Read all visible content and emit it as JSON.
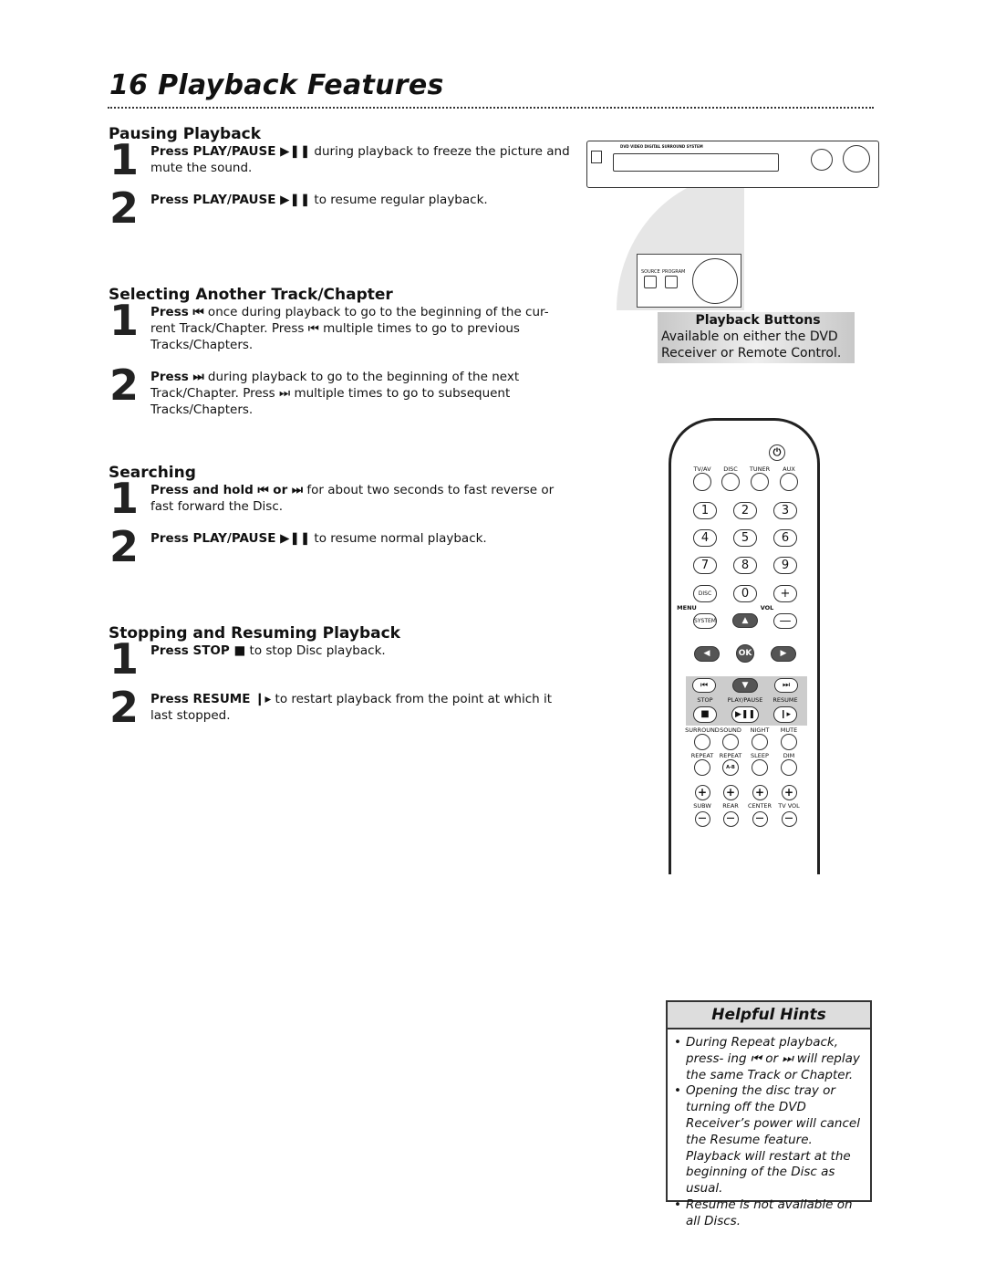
{
  "title": "16 Playback Features",
  "sections": [
    {
      "heading": "Pausing Playback",
      "steps": [
        {
          "n": "1",
          "bold": "Press PLAY/PAUSE ▶❚❚",
          "rest": " during playback to freeze the picture and mute the sound."
        },
        {
          "n": "2",
          "bold": "Press PLAY/PAUSE ▶❚❚",
          "rest": " to resume regular playback."
        }
      ]
    },
    {
      "heading": "Selecting Another Track/Chapter",
      "steps": [
        {
          "n": "1",
          "bold": "Press ⏮",
          "rest": " once during playback to go to the beginning of the cur- rent Track/Chapter. Press ⏮ multiple times to go to previous Tracks/Chapters."
        },
        {
          "n": "2",
          "bold": "Press ⏭",
          "rest": " during playback to go to the beginning of the next Track/Chapter. Press ⏭ multiple times to go to subsequent Tracks/Chapters."
        }
      ]
    },
    {
      "heading": "Searching",
      "steps": [
        {
          "n": "1",
          "bold": "Press and hold ⏮ or ⏭",
          "rest": " for about two seconds to fast reverse or fast forward the Disc."
        },
        {
          "n": "2",
          "bold": "Press PLAY/PAUSE ▶❚❚",
          "rest": " to resume normal playback."
        }
      ]
    },
    {
      "heading": "Stopping and Resuming Playback",
      "steps": [
        {
          "n": "1",
          "bold": "Press STOP ■",
          "rest": " to stop Disc playback."
        },
        {
          "n": "2",
          "bold": "Press RESUME ❙▸",
          "rest": " to restart playback from the point at which it last stopped."
        }
      ]
    }
  ],
  "caption": {
    "heading": "Playback Buttons",
    "text": "Available on either the DVD Receiver or Remote Control."
  },
  "player": {
    "label": "DVD VIDEO DIGITAL SURROUND SYSTEM",
    "zoom_labels": [
      "SOURCE",
      "PROGRAM"
    ]
  },
  "remote": {
    "source_labels": [
      "TV/AV",
      "DISC",
      "TUNER",
      "AUX"
    ],
    "numbers": [
      "1",
      "2",
      "3",
      "4",
      "5",
      "6",
      "7",
      "8",
      "9",
      "0"
    ],
    "disc": "DISC",
    "menu": "MENU",
    "system": "SYSTEM",
    "vol": "VOL",
    "plus": "+",
    "minus": "—",
    "ok": "OK",
    "transport_labels": [
      "STOP",
      "PLAY/PAUSE",
      "RESUME"
    ],
    "row1_labels": [
      "SURROUND",
      "SOUND",
      "NIGHT",
      "MUTE"
    ],
    "row2_labels": [
      "REPEAT",
      "REPEAT",
      "SLEEP",
      "DIM"
    ],
    "ab": "A-B",
    "vol_labels": [
      "SUBW",
      "REAR",
      "CENTER",
      "TV VOL"
    ]
  },
  "hints": {
    "heading": "Helpful Hints",
    "items": [
      "During Repeat playback, press- ing ⏮ or ⏭ will replay the same Track or Chapter.",
      "Opening the disc tray or turning off the DVD Receiver’s power will cancel the Resume feature. Playback will restart at the beginning of the Disc as usual.",
      "Resume is not available on all Discs."
    ]
  }
}
